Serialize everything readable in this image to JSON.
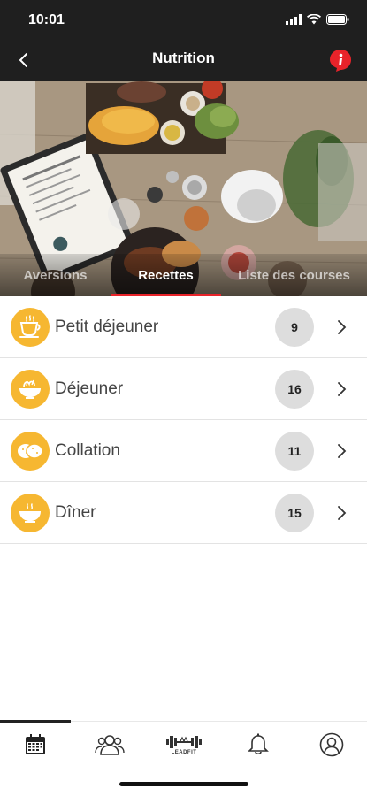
{
  "status_bar": {
    "time": "10:01",
    "icons": [
      "cellular-signal-icon",
      "wifi-icon",
      "battery-icon"
    ]
  },
  "nav": {
    "title": "Nutrition",
    "back_icon": "chevron-left-icon",
    "info_icon": "info-badge-icon",
    "accent_color": "#e8232a"
  },
  "hero": {
    "image": "food-table-photo",
    "tabs": [
      {
        "label": "Aversions",
        "active": false
      },
      {
        "label": "Recettes",
        "active": true
      },
      {
        "label": "Liste des courses",
        "active": false
      }
    ]
  },
  "meals": [
    {
      "label": "Petit déjeuner",
      "count": "9",
      "icon": "coffee-cup-icon"
    },
    {
      "label": "Déjeuner",
      "count": "16",
      "icon": "salad-bowl-icon"
    },
    {
      "label": "Collation",
      "count": "11",
      "icon": "cookies-icon"
    },
    {
      "label": "Dîner",
      "count": "15",
      "icon": "dinner-bowl-icon"
    }
  ],
  "meal_icon_color": "#f6b731",
  "bottom_nav": {
    "items": [
      {
        "name": "calendar-icon",
        "active": true
      },
      {
        "name": "community-icon",
        "active": false
      },
      {
        "name": "leadfit-logo",
        "active": false
      },
      {
        "name": "bell-icon",
        "active": false
      },
      {
        "name": "profile-icon",
        "active": false
      }
    ],
    "logo_text": "LEADFIT"
  }
}
